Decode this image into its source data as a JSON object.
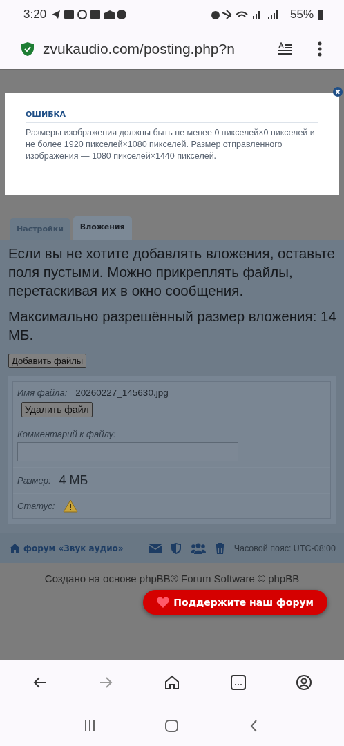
{
  "status_bar": {
    "time": "3:20",
    "battery": "55%"
  },
  "address_bar": {
    "url": "zvukaudio.com/posting.php?n"
  },
  "error_dialog": {
    "title": "ОШИБКА",
    "message": "Размеры изображения должны быть не менее 0 пикселей×0 пикселей и не более 1920 пикселей×1080 пикселей. Размер отправленного изображения — 1080 пикселей×1440 пикселей."
  },
  "tabs": [
    {
      "label": "Настройки",
      "selected": false
    },
    {
      "label": "Вложения",
      "selected": true
    }
  ],
  "panel": {
    "intro": "Если вы не хотите добавлять вложения, оставьте поля пустыми. Можно прикреплять файлы, перетаскивая их в окно сообщения.",
    "max_size": "Максимально разрешённый размер вложения: 14 МБ.",
    "add_button": "Добавить файлы",
    "attachment": {
      "filename_label": "Имя файла:",
      "filename": "20260227_145630.jpg",
      "delete_button": "Удалить файл",
      "comment_label": "Комментарий к файлу:",
      "size_label": "Размер:",
      "size": "4 МБ",
      "status_label": "Статус:"
    }
  },
  "footer_nav": {
    "home_link": "форум «Звук аудио»",
    "timezone": "Часовой пояс: UTC-08:00"
  },
  "footer": {
    "credit": "Создано на основе phpBB® Forum Software © phpBB",
    "support_button": "Поддержите наш форум"
  }
}
